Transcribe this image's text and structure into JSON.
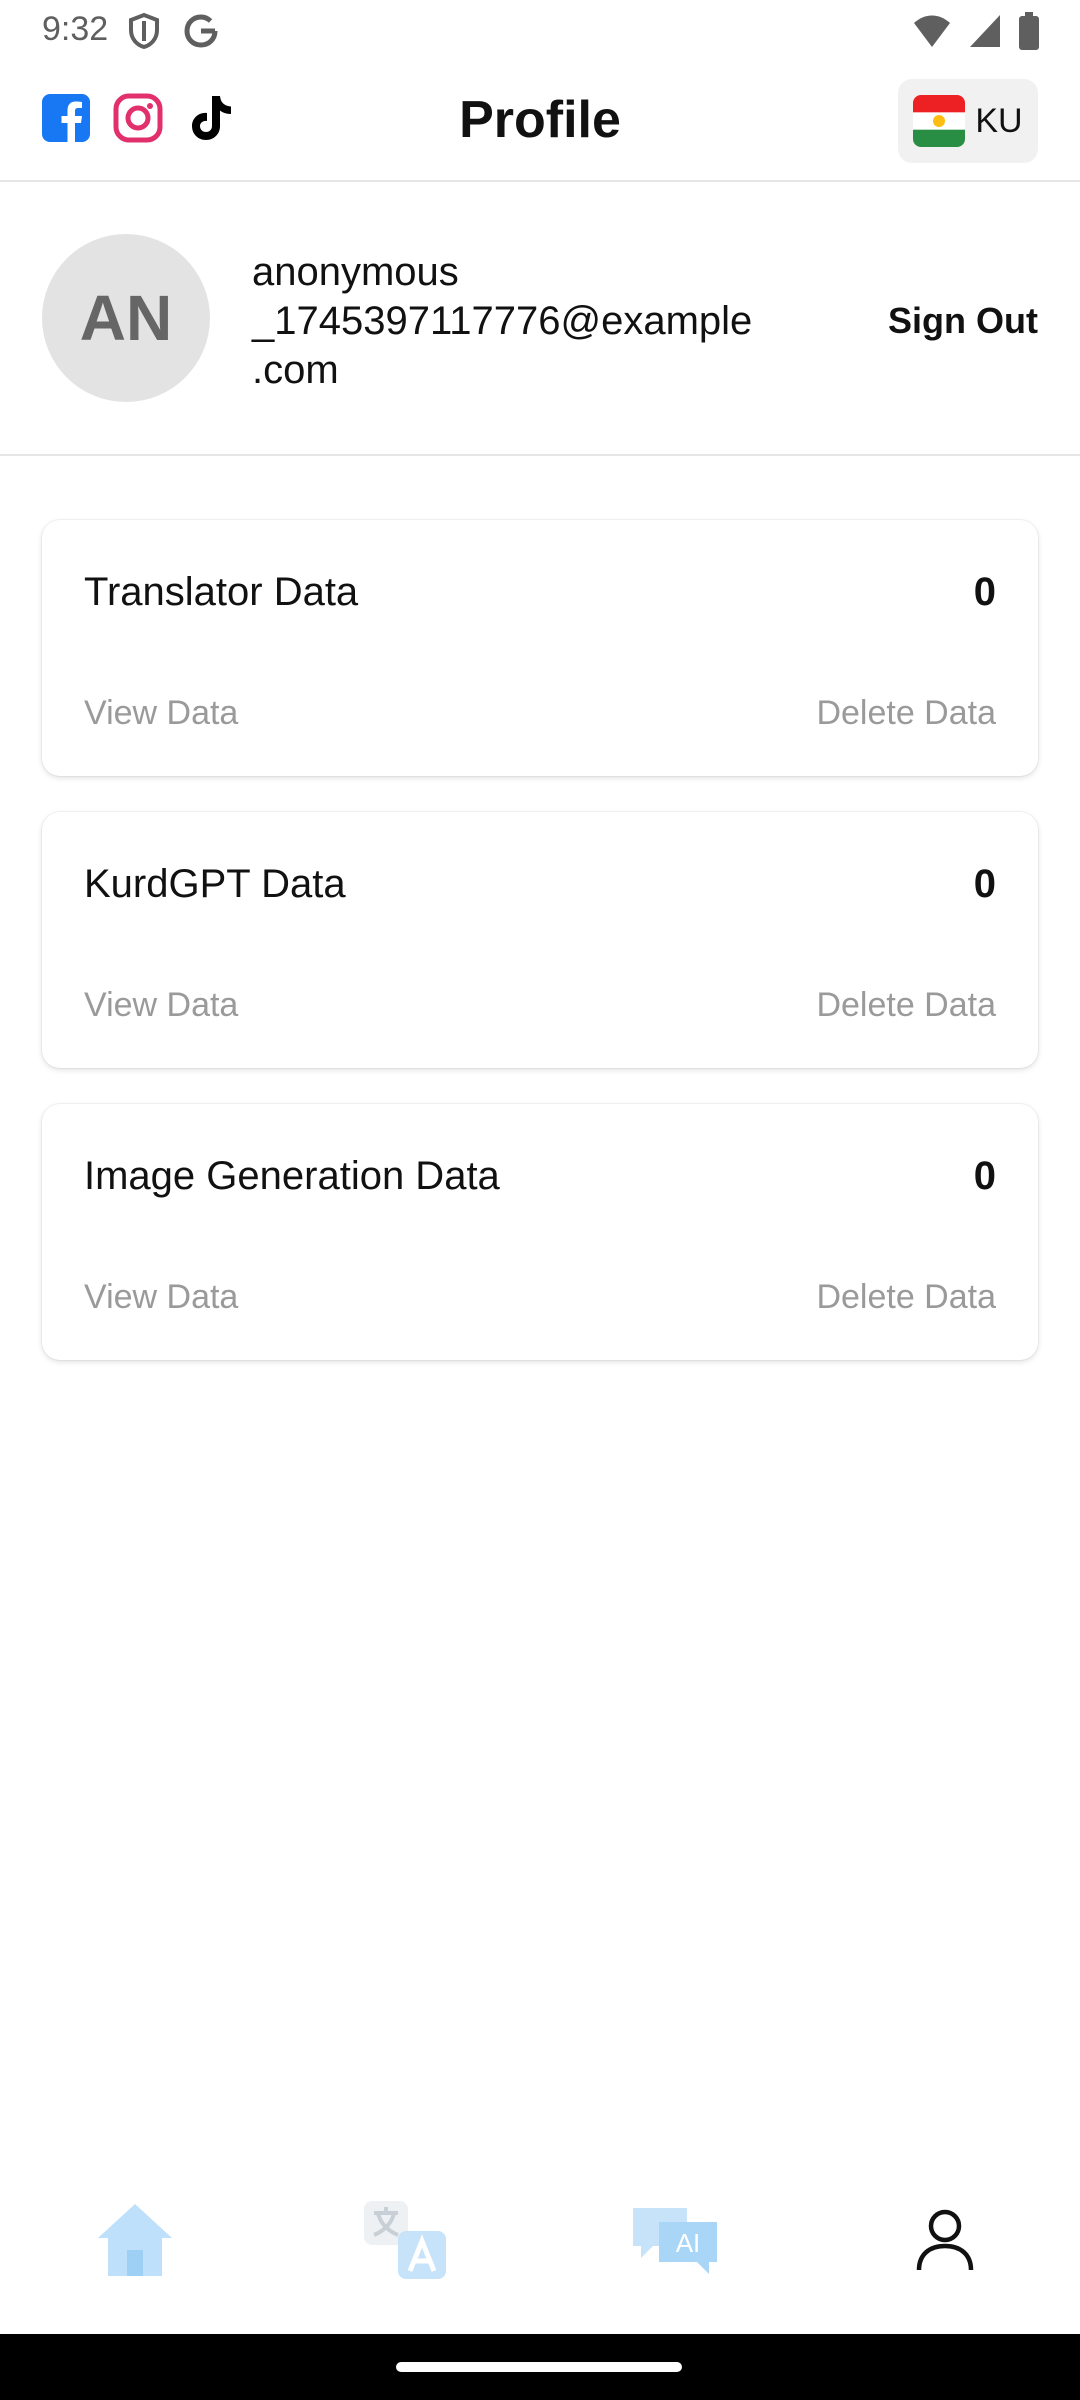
{
  "status_bar": {
    "time": "9:32"
  },
  "header": {
    "title": "Profile",
    "language_code": "KU",
    "social": [
      "facebook-icon",
      "instagram-icon",
      "tiktok-icon"
    ]
  },
  "profile": {
    "initials": "AN",
    "email_lines": [
      "anonymous",
      "_1745397117776@example",
      ".com"
    ],
    "sign_out_label": "Sign Out"
  },
  "cards": [
    {
      "title": "Translator Data",
      "count": "0",
      "view_label": "View Data",
      "delete_label": "Delete Data"
    },
    {
      "title": "KurdGPT Data",
      "count": "0",
      "view_label": "View Data",
      "delete_label": "Delete Data"
    },
    {
      "title": "Image Generation Data",
      "count": "0",
      "view_label": "View Data",
      "delete_label": "Delete Data"
    }
  ],
  "bottom_nav": {
    "items": [
      "home-icon",
      "translate-icon",
      "ai-chat-icon",
      "profile-icon"
    ],
    "ai_badge_text": "AI"
  },
  "colors": {
    "facebook": "#1877F2",
    "instagram": "#E1306C",
    "nav_inactive": "#BFE0FA",
    "muted_text": "#9A9A9A"
  }
}
